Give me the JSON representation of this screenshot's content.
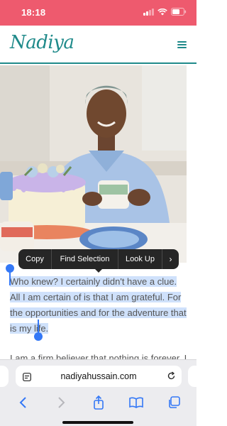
{
  "status_bar": {
    "time": "18:18"
  },
  "site": {
    "logo": "Nadiya"
  },
  "article": {
    "paragraph1": "Who knew? I certainly didn't have a clue. All I am certain of is that I am grateful. For the opportunities and for the adventure that is my life.",
    "paragraph2": "I am a firm believer that nothing is forever. I"
  },
  "callout_menu": {
    "copy": "Copy",
    "find_selection": "Find Selection",
    "look_up": "Look Up",
    "more": "›"
  },
  "browser": {
    "url": "nadiyahussain.com"
  },
  "colors": {
    "brand": "#1f8a8a",
    "status_bar": "#ee5a6e",
    "selection": "#cfe1fb",
    "accent": "#3478f6"
  },
  "icons": [
    "signal-icon",
    "wifi-icon",
    "battery-icon",
    "menu-icon",
    "page-menu-icon",
    "reload-icon",
    "back-icon",
    "forward-icon",
    "share-icon",
    "bookmarks-icon",
    "tabs-icon"
  ]
}
